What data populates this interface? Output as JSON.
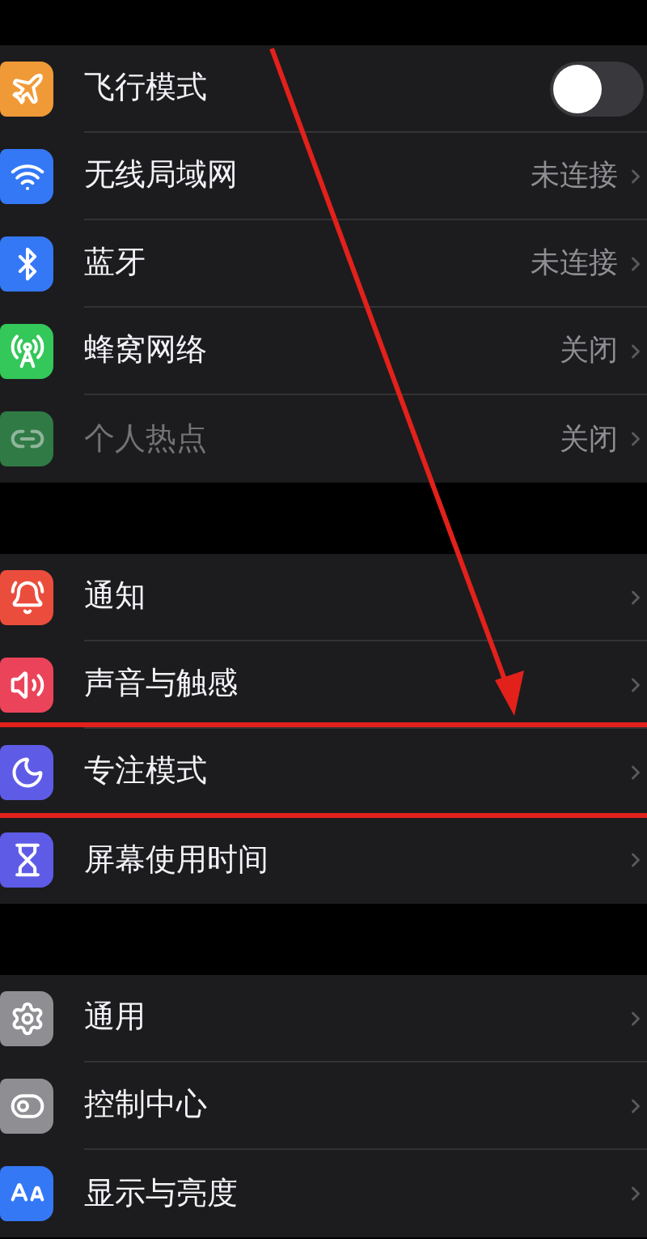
{
  "groups": [
    {
      "rows": [
        {
          "kind": "toggle",
          "label": "飞行模式",
          "color": "#f09a37",
          "on": false,
          "disabled": false
        },
        {
          "kind": "link",
          "label": "无线局域网",
          "value": "未连接",
          "color": "#3478f6",
          "disabled": false
        },
        {
          "kind": "link",
          "label": "蓝牙",
          "value": "未连接",
          "color": "#3478f6",
          "disabled": false
        },
        {
          "kind": "link",
          "label": "蜂窝网络",
          "value": "关闭",
          "color": "#34c759",
          "disabled": false
        },
        {
          "kind": "link",
          "label": "个人热点",
          "value": "关闭",
          "color": "#2f7a45",
          "disabled": true
        }
      ]
    },
    {
      "rows": [
        {
          "kind": "link",
          "label": "通知",
          "color": "#eb4d3d",
          "disabled": false
        },
        {
          "kind": "link",
          "label": "声音与触感",
          "color": "#eb445a",
          "disabled": false
        },
        {
          "kind": "link",
          "label": "专注模式",
          "color": "#5e5ce6",
          "disabled": false
        },
        {
          "kind": "link",
          "label": "屏幕使用时间",
          "color": "#5e5ce6",
          "disabled": false
        }
      ]
    },
    {
      "rows": [
        {
          "kind": "link",
          "label": "通用",
          "color": "#8e8e93",
          "disabled": false
        },
        {
          "kind": "link",
          "label": "控制中心",
          "color": "#8e8e93",
          "disabled": false
        },
        {
          "kind": "link",
          "label": "显示与亮度",
          "color": "#3478f6",
          "disabled": false
        }
      ]
    }
  ]
}
